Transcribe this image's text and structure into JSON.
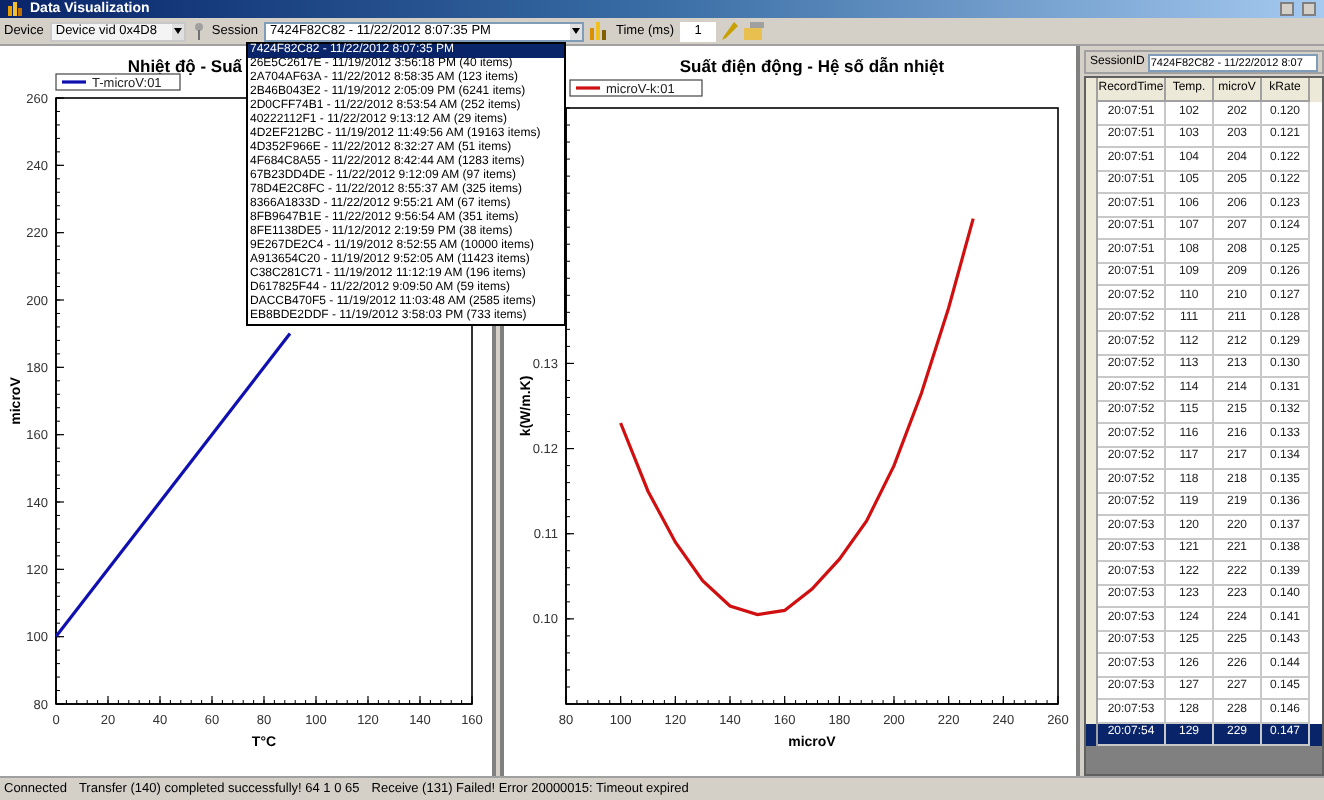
{
  "window": {
    "title": "Data Visualization"
  },
  "toolbar": {
    "device_label": "Device",
    "device": "Device vid 0x4D8",
    "session_label": "Session",
    "session": "7424F82C82 - 11/22/2012 8:07:35 PM",
    "time_label": "Time (ms)",
    "time_value": "1"
  },
  "session_dropdown": {
    "items": [
      {
        "label": "7424F82C82 - 11/22/2012 8:07:35 PM",
        "selected": true
      },
      {
        "label": "26E5C2617E - 11/19/2012 3:56:18 PM (40 items)",
        "selected": false
      },
      {
        "label": "2A704AF63A - 11/22/2012 8:58:35 AM (123 items)",
        "selected": false
      },
      {
        "label": "2B46B043E2 - 11/19/2012 2:05:09 PM (6241 items)",
        "selected": false
      },
      {
        "label": "2D0CFF74B1 - 11/22/2012 8:53:54 AM (252 items)",
        "selected": false
      },
      {
        "label": "40222112F1 - 11/22/2012 9:13:12 AM (29 items)",
        "selected": false
      },
      {
        "label": "4D2EF212BC - 11/19/2012 11:49:56 AM (19163 items)",
        "selected": false
      },
      {
        "label": "4D352F966E - 11/22/2012 8:32:27 AM (51 items)",
        "selected": false
      },
      {
        "label": "4F684C8A55 - 11/22/2012 8:42:44 AM (1283 items)",
        "selected": false
      },
      {
        "label": "67B23DD4DE - 11/22/2012 9:12:09 AM (97 items)",
        "selected": false
      },
      {
        "label": "78D4E2C8FC - 11/22/2012 8:55:37 AM (325 items)",
        "selected": false
      },
      {
        "label": "8366A1833D - 11/22/2012 9:55:21 AM (67 items)",
        "selected": false
      },
      {
        "label": "8FB9647B1E - 11/22/2012 9:56:54 AM (351 items)",
        "selected": false
      },
      {
        "label": "8FE1138DE5 - 11/12/2012 2:19:59 PM (38 items)",
        "selected": false
      },
      {
        "label": "9E267DE2C4 - 11/19/2012 8:52:55 AM (10000 items)",
        "selected": false
      },
      {
        "label": "A913654C20 - 11/19/2012 9:52:05 AM (11423 items)",
        "selected": false
      },
      {
        "label": "C38C281C71 - 11/19/2012 11:12:19 AM (196 items)",
        "selected": false
      },
      {
        "label": "D617825F44 - 11/22/2012 9:09:50 AM (59 items)",
        "selected": false
      },
      {
        "label": "DACCB470F5 - 11/19/2012 11:03:48 AM (2585 items)",
        "selected": false
      },
      {
        "label": "EB8BDE2DDF - 11/19/2012 3:58:03 PM (733 items)",
        "selected": false
      }
    ]
  },
  "temp_chart": {
    "chart_data": {
      "type": "line",
      "title": "Nhiệt độ - Suấ",
      "xlabel": "T°C",
      "ylabel": "microV",
      "x": [
        0,
        90
      ],
      "series": [
        {
          "name": "T-microV:01",
          "color": "#1010b0",
          "values": [
            100,
            190
          ]
        }
      ],
      "xlim": [
        0,
        160
      ],
      "ylim": [
        80,
        260
      ],
      "xticks": [
        0,
        20,
        40,
        60,
        80,
        100,
        120,
        140,
        160
      ],
      "yticks": [
        80,
        100,
        120,
        140,
        160,
        180,
        200,
        220,
        240,
        260
      ]
    }
  },
  "k_chart": {
    "chart_data": {
      "type": "line",
      "title": "Suất điện động - Hệ số dẫn nhiệt",
      "xlabel": "microV",
      "ylabel": "k(W/m.K)",
      "x": [
        100,
        110,
        120,
        130,
        140,
        150,
        160,
        170,
        180,
        190,
        200,
        210,
        220,
        229
      ],
      "series": [
        {
          "name": "microV-k:01",
          "color": "#d01010",
          "values": [
            0.123,
            0.115,
            0.109,
            0.1045,
            0.1015,
            0.1005,
            0.101,
            0.1035,
            0.107,
            0.1115,
            0.118,
            0.1265,
            0.1365,
            0.147
          ]
        }
      ],
      "xlim": [
        80,
        260
      ],
      "ylim": [
        0.09,
        0.16
      ],
      "xticks": [
        80,
        100,
        120,
        140,
        160,
        180,
        200,
        220,
        240,
        260
      ],
      "yticks": [
        {
          "value": 0.1,
          "label": "0.10"
        },
        {
          "value": 0.11,
          "label": "0.11"
        },
        {
          "value": 0.12,
          "label": "0.12"
        },
        {
          "value": 0.13,
          "label": "0.13"
        }
      ]
    }
  },
  "table": {
    "session_label": "SessionID",
    "session_value": "7424F82C82 - 11/22/2012 8:07",
    "columns": [
      "RecordTime",
      "Temp.",
      "microV",
      "kRate"
    ],
    "rows": [
      {
        "cells": [
          "20:07:51",
          "102",
          "202",
          "0.120"
        ],
        "selected": false
      },
      {
        "cells": [
          "20:07:51",
          "103",
          "203",
          "0.121"
        ],
        "selected": false
      },
      {
        "cells": [
          "20:07:51",
          "104",
          "204",
          "0.122"
        ],
        "selected": false
      },
      {
        "cells": [
          "20:07:51",
          "105",
          "205",
          "0.122"
        ],
        "selected": false
      },
      {
        "cells": [
          "20:07:51",
          "106",
          "206",
          "0.123"
        ],
        "selected": false
      },
      {
        "cells": [
          "20:07:51",
          "107",
          "207",
          "0.124"
        ],
        "selected": false
      },
      {
        "cells": [
          "20:07:51",
          "108",
          "208",
          "0.125"
        ],
        "selected": false
      },
      {
        "cells": [
          "20:07:51",
          "109",
          "209",
          "0.126"
        ],
        "selected": false
      },
      {
        "cells": [
          "20:07:52",
          "110",
          "210",
          "0.127"
        ],
        "selected": false
      },
      {
        "cells": [
          "20:07:52",
          "111",
          "211",
          "0.128"
        ],
        "selected": false
      },
      {
        "cells": [
          "20:07:52",
          "112",
          "212",
          "0.129"
        ],
        "selected": false
      },
      {
        "cells": [
          "20:07:52",
          "113",
          "213",
          "0.130"
        ],
        "selected": false
      },
      {
        "cells": [
          "20:07:52",
          "114",
          "214",
          "0.131"
        ],
        "selected": false
      },
      {
        "cells": [
          "20:07:52",
          "115",
          "215",
          "0.132"
        ],
        "selected": false
      },
      {
        "cells": [
          "20:07:52",
          "116",
          "216",
          "0.133"
        ],
        "selected": false
      },
      {
        "cells": [
          "20:07:52",
          "117",
          "217",
          "0.134"
        ],
        "selected": false
      },
      {
        "cells": [
          "20:07:52",
          "118",
          "218",
          "0.135"
        ],
        "selected": false
      },
      {
        "cells": [
          "20:07:52",
          "119",
          "219",
          "0.136"
        ],
        "selected": false
      },
      {
        "cells": [
          "20:07:53",
          "120",
          "220",
          "0.137"
        ],
        "selected": false
      },
      {
        "cells": [
          "20:07:53",
          "121",
          "221",
          "0.138"
        ],
        "selected": false
      },
      {
        "cells": [
          "20:07:53",
          "122",
          "222",
          "0.139"
        ],
        "selected": false
      },
      {
        "cells": [
          "20:07:53",
          "123",
          "223",
          "0.140"
        ],
        "selected": false
      },
      {
        "cells": [
          "20:07:53",
          "124",
          "224",
          "0.141"
        ],
        "selected": false
      },
      {
        "cells": [
          "20:07:53",
          "125",
          "225",
          "0.143"
        ],
        "selected": false
      },
      {
        "cells": [
          "20:07:53",
          "126",
          "226",
          "0.144"
        ],
        "selected": false
      },
      {
        "cells": [
          "20:07:53",
          "127",
          "227",
          "0.145"
        ],
        "selected": false
      },
      {
        "cells": [
          "20:07:53",
          "128",
          "228",
          "0.146"
        ],
        "selected": false
      },
      {
        "cells": [
          "20:07:54",
          "129",
          "229",
          "0.147"
        ],
        "selected": true
      }
    ]
  },
  "status_bar": [
    "Connected",
    "Transfer (140) completed successfully! 64 1 0 65",
    "Receive (131) Failed! Error 20000015: Timeout expired"
  ]
}
